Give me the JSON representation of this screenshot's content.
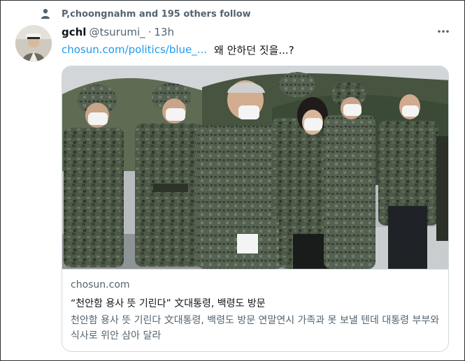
{
  "social_context": {
    "icon": "person-icon",
    "text": "P,choongnahm and 195 others follow"
  },
  "tweet": {
    "display_name": "gchl",
    "handle": "@tsurumi_",
    "separator": "·",
    "time": "13h",
    "link_text": "chosun.com/politics/blue_...",
    "body_text": "왜 안하던 짓을...?",
    "more_icon": "more-horizontal-icon"
  },
  "card": {
    "image_icon": "photo-soldiers-in-camouflage",
    "domain": "chosun.com",
    "title": "“천안함 용사 뜻 기린다” 文대통령, 백령도 방문",
    "description": "천안함 용사 뜻 기린다 文대통령, 백령도 방문 연말연시 가족과 못 보낼 텐데 대통령 부부와 식사로 위안 삼아 달라"
  },
  "colors": {
    "link": "#1d9bf0",
    "secondary_text": "#536471",
    "primary_text": "#0f1419",
    "card_border": "#cfd9de",
    "frame_border": "#2f3336"
  }
}
